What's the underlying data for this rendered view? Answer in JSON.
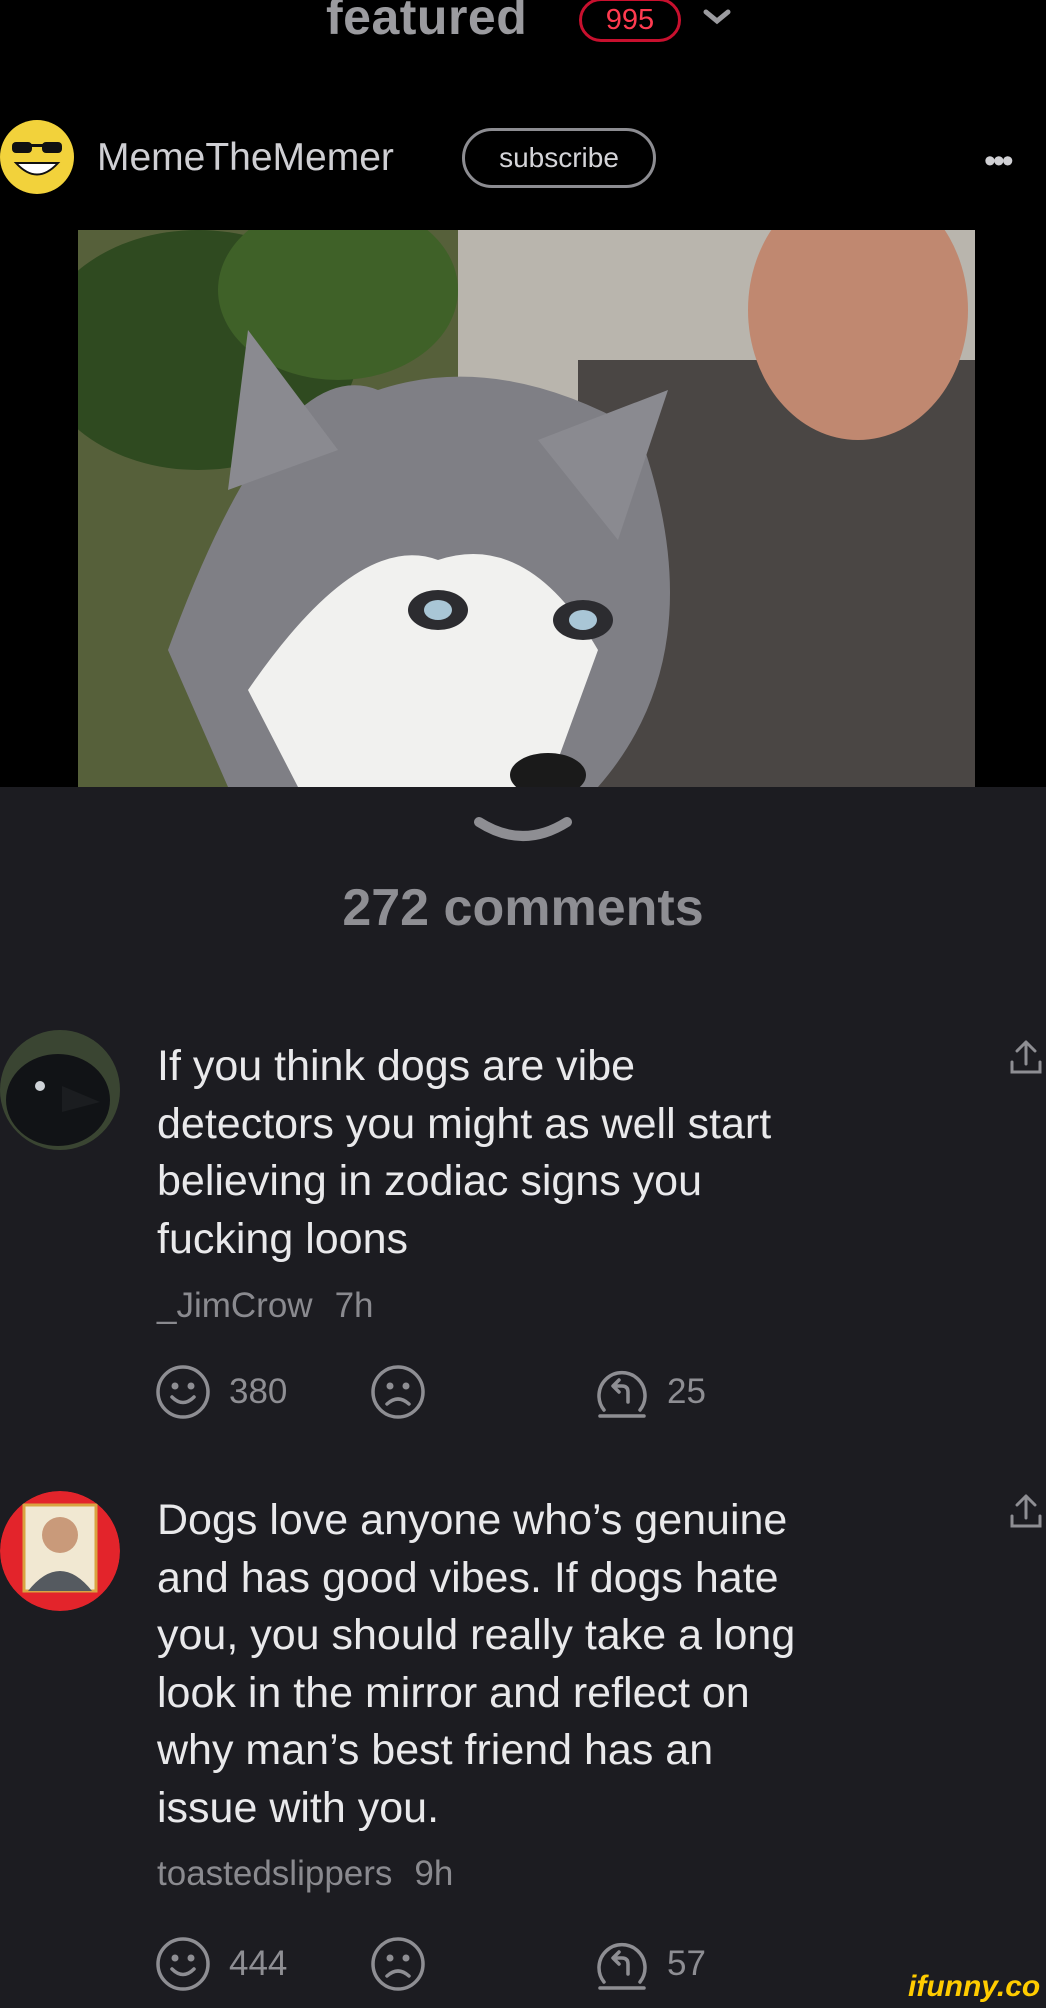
{
  "header": {
    "feed_title": "featured",
    "badge_count": "995",
    "username": "MemeTheMemer",
    "subscribe_label": "subscribe",
    "more_label": "•••"
  },
  "post": {
    "comments_count": "272 comments"
  },
  "comments": [
    {
      "text": "If you think dogs are vibe\ndetectors you might as well start\nbelieving in zodiac signs you\nfucking loons",
      "author": "_JimCrow",
      "time": "7h",
      "smiles": "380",
      "replies": "25"
    },
    {
      "text": "Dogs love anyone who’s genuine\nand has good vibes. If dogs hate\nyou, you should really take a long\nlook in the mirror and reflect on\nwhy man’s best friend has an\nissue with you.",
      "author": "toastedslippers",
      "time": "9h",
      "smiles": "444",
      "replies": "57"
    }
  ],
  "watermark": "ifunny.co",
  "colors": {
    "background": "#1c1c21",
    "badge_red": "#c8102e",
    "avatar_yellow": "#f2d23b",
    "watermark_yellow": "#ffcc00"
  }
}
